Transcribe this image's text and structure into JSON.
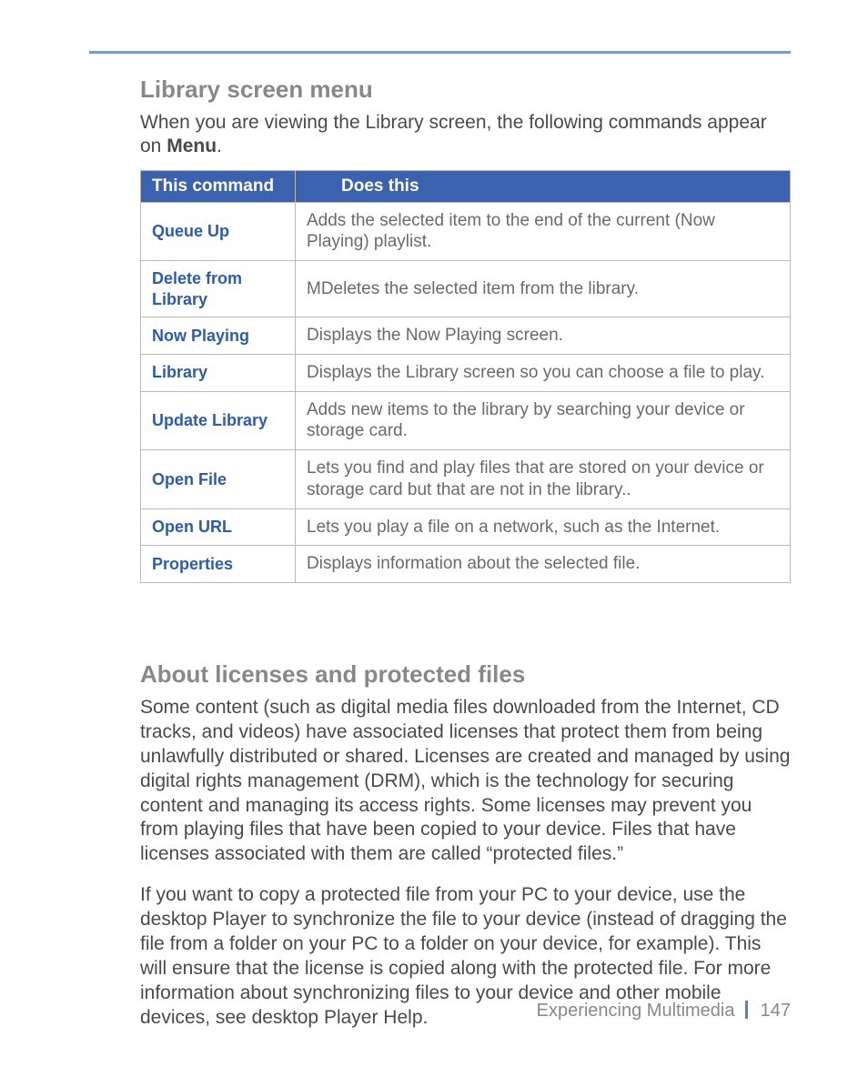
{
  "section1": {
    "title": "Library screen menu",
    "intro_pre": "When you are viewing the Library screen, the following commands appear on ",
    "intro_bold": "Menu",
    "intro_post": "."
  },
  "table": {
    "header": {
      "col1": "This command",
      "col2": "Does this"
    },
    "rows": [
      {
        "cmd": "Queue Up",
        "desc": "Adds the selected item to the end of the current (Now Playing) playlist."
      },
      {
        "cmd": "Delete from Library",
        "desc": "MDeletes the selected item from the library."
      },
      {
        "cmd": "Now Playing",
        "desc": "Displays the Now Playing screen."
      },
      {
        "cmd": "Library",
        "desc": "Displays the Library screen so you can choose a file to play."
      },
      {
        "cmd": "Update Library",
        "desc": "Adds new items to the library by searching your device or storage card."
      },
      {
        "cmd": "Open File",
        "desc": "Lets you find and play files that are stored on your device or storage card but that are not in the library.."
      },
      {
        "cmd": "Open URL",
        "desc": "Lets you play a file on a network, such as the Internet."
      },
      {
        "cmd": "Properties",
        "desc": "Displays information about the selected file."
      }
    ]
  },
  "section2": {
    "title": "About licenses and protected files",
    "para1": "Some content (such as digital media files downloaded from the Internet, CD tracks, and videos) have associated licenses that protect them from being unlawfully distributed or shared. Licenses are created and managed by using digital rights management (DRM), which is the technology for securing content and managing its access rights. Some licenses may prevent you from playing files that have been copied to your device. Files that have licenses associated with them are called “protected files.”",
    "para2": "If you want to copy a protected file from your PC to your device, use the desktop Player to synchronize the file to your device (instead of dragging the file from a folder on your PC to a folder on your device, for example). This will ensure that the license is copied along with the protected file. For more information about synchronizing files to your device and other mobile devices, see desktop Player Help."
  },
  "footer": {
    "chapter": "Experiencing Multimedia",
    "page": "147"
  }
}
